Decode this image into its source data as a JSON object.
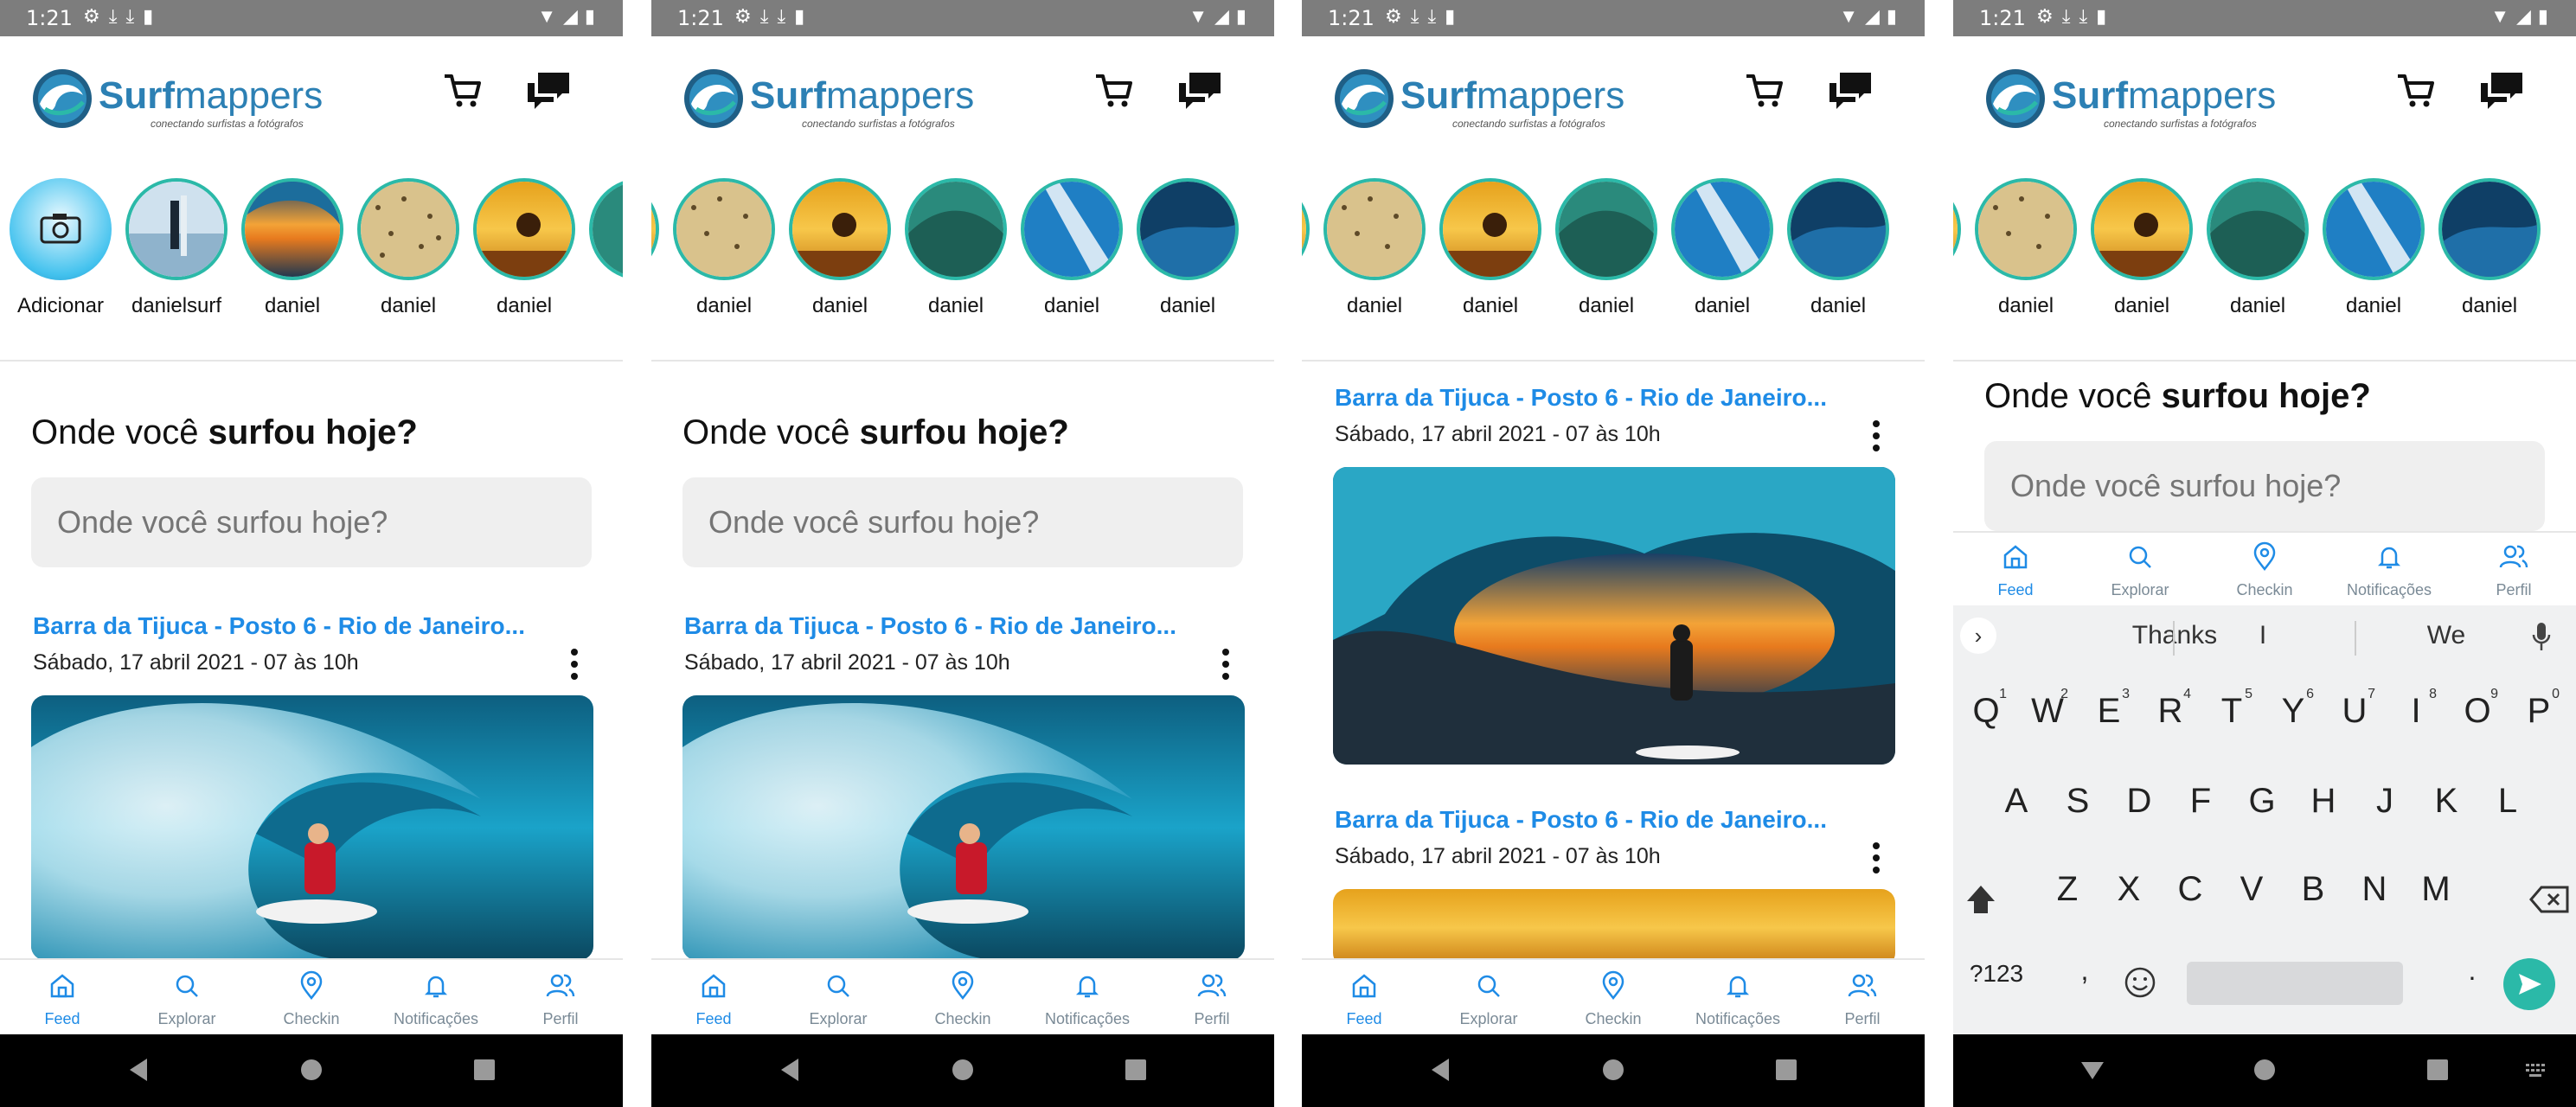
{
  "status": {
    "time": "1:21",
    "left_icons": [
      "gear-icon",
      "download-icon",
      "download-icon",
      "sd-card-icon"
    ],
    "right_icons": [
      "wifi-icon",
      "signal-icon",
      "battery-icon"
    ]
  },
  "brand": {
    "name_bold": "Surf",
    "name_rest": "mappers",
    "tagline": "conectando surfistas a fotógrafos",
    "color": "#2c80b4"
  },
  "colors": {
    "accent": "#1e8be6",
    "ring": "#2bb9a8",
    "nav_inactive": "#7a8a96",
    "statusbar": "#7d7d7d",
    "send": "#2bb9a8"
  },
  "screens": [
    {
      "stories": [
        {
          "label": "Adicionar",
          "kind": "add"
        },
        {
          "label": "danielsurf",
          "kind": "photo"
        },
        {
          "label": "daniel",
          "kind": "photo"
        },
        {
          "label": "daniel",
          "kind": "photo"
        },
        {
          "label": "daniel",
          "kind": "photo"
        }
      ]
    },
    {
      "stories": [
        {
          "label": "daniel"
        },
        {
          "label": "daniel"
        },
        {
          "label": "daniel"
        },
        {
          "label": "daniel"
        },
        {
          "label": "daniel"
        }
      ]
    },
    {
      "stories": [
        {
          "label": "daniel"
        },
        {
          "label": "daniel"
        },
        {
          "label": "daniel"
        },
        {
          "label": "daniel"
        },
        {
          "label": "daniel"
        }
      ]
    },
    {
      "stories": [
        {
          "label": "daniel"
        },
        {
          "label": "daniel"
        },
        {
          "label": "daniel"
        },
        {
          "label": "daniel"
        },
        {
          "label": "daniel"
        }
      ]
    }
  ],
  "compose": {
    "title_plain": "Onde você ",
    "title_bold": "surfou hoje?",
    "placeholder": "Onde você surfou hoje?"
  },
  "post": {
    "location": "Barra da Tijuca - Posto 6 - Rio de Janeiro...",
    "date": "Sábado, 17 abril 2021 - 07 às 10h"
  },
  "nav": [
    {
      "label": "Feed",
      "icon": "home-icon"
    },
    {
      "label": "Explorar",
      "icon": "search-icon"
    },
    {
      "label": "Checkin",
      "icon": "location-pin-icon"
    },
    {
      "label": "Notificações",
      "icon": "bell-icon"
    },
    {
      "label": "Perfil",
      "icon": "people-icon"
    }
  ],
  "keyboard": {
    "suggestions": [
      "Thanks",
      "I",
      "We"
    ],
    "row1": [
      "Q",
      "W",
      "E",
      "R",
      "T",
      "Y",
      "U",
      "I",
      "O",
      "P"
    ],
    "row1_digits": [
      "1",
      "2",
      "3",
      "4",
      "5",
      "6",
      "7",
      "8",
      "9",
      "0"
    ],
    "row2": [
      "A",
      "S",
      "D",
      "F",
      "G",
      "H",
      "J",
      "K",
      "L"
    ],
    "row3": [
      "Z",
      "X",
      "C",
      "V",
      "B",
      "N",
      "M"
    ],
    "symbols_key": "?123",
    "comma": ",",
    "period": "."
  }
}
